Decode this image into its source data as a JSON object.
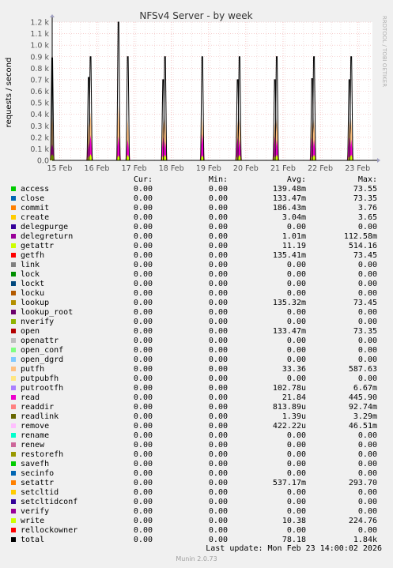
{
  "chart_data": {
    "type": "area",
    "title": "NFSv4 Server - by week",
    "ylabel": "requests / second",
    "watermark": "RRDTOOL / TOBI OETIKER",
    "ylim": [
      0,
      1200
    ],
    "yticks": [
      {
        "v": 0,
        "label": "0.0"
      },
      {
        "v": 100,
        "label": "0.1 k"
      },
      {
        "v": 200,
        "label": "0.2 k"
      },
      {
        "v": 300,
        "label": "0.3 k"
      },
      {
        "v": 400,
        "label": "0.4 k"
      },
      {
        "v": 500,
        "label": "0.5 k"
      },
      {
        "v": 600,
        "label": "0.6 k"
      },
      {
        "v": 700,
        "label": "0.7 k"
      },
      {
        "v": 800,
        "label": "0.8 k"
      },
      {
        "v": 900,
        "label": "0.9 k"
      },
      {
        "v": 1000,
        "label": "1.0 k"
      },
      {
        "v": 1100,
        "label": "1.1 k"
      },
      {
        "v": 1200,
        "label": "1.2 k"
      }
    ],
    "xlim": [
      0,
      8.6
    ],
    "xticks": [
      {
        "v": 0.2,
        "label": "15 Feb"
      },
      {
        "v": 1.2,
        "label": "16 Feb"
      },
      {
        "v": 2.2,
        "label": "17 Feb"
      },
      {
        "v": 3.2,
        "label": "18 Feb"
      },
      {
        "v": 4.2,
        "label": "19 Feb"
      },
      {
        "v": 5.2,
        "label": "20 Feb"
      },
      {
        "v": 6.2,
        "label": "21 Feb"
      },
      {
        "v": 7.2,
        "label": "22 Feb"
      },
      {
        "v": 8.2,
        "label": "23 Feb"
      }
    ],
    "spikes": [
      {
        "x": 0.0,
        "total": 890,
        "putfh": 455,
        "read": 170,
        "write": 65
      },
      {
        "x": 0.98,
        "total": 720,
        "putfh": 330,
        "read": 150,
        "write": 40
      },
      {
        "x": 1.03,
        "total": 900,
        "putfh": 420,
        "read": 220,
        "write": 55
      },
      {
        "x": 1.78,
        "total": 1200,
        "putfh": 480,
        "read": 210,
        "write": 45
      },
      {
        "x": 2.03,
        "total": 900,
        "putfh": 360,
        "read": 180,
        "write": 50
      },
      {
        "x": 2.98,
        "total": 700,
        "putfh": 340,
        "read": 200,
        "write": 45
      },
      {
        "x": 3.03,
        "total": 900,
        "putfh": 360,
        "read": 170,
        "write": 50
      },
      {
        "x": 4.03,
        "total": 900,
        "putfh": 370,
        "read": 230,
        "write": 45
      },
      {
        "x": 4.98,
        "total": 700,
        "putfh": 340,
        "read": 200,
        "write": 40
      },
      {
        "x": 5.03,
        "total": 900,
        "putfh": 360,
        "read": 180,
        "write": 50
      },
      {
        "x": 5.98,
        "total": 700,
        "putfh": 330,
        "read": 210,
        "write": 45
      },
      {
        "x": 6.03,
        "total": 900,
        "putfh": 360,
        "read": 180,
        "write": 50
      },
      {
        "x": 6.98,
        "total": 710,
        "putfh": 330,
        "read": 200,
        "write": 45
      },
      {
        "x": 7.03,
        "total": 900,
        "putfh": 360,
        "read": 180,
        "write": 50
      },
      {
        "x": 7.98,
        "total": 700,
        "putfh": 340,
        "read": 200,
        "write": 40
      },
      {
        "x": 8.03,
        "total": 900,
        "putfh": 360,
        "read": 180,
        "write": 50
      }
    ],
    "grid": true
  },
  "legend": {
    "headers": {
      "cur": "Cur:",
      "min": "Min:",
      "avg": "Avg:",
      "max": "Max:"
    },
    "rows": [
      {
        "name": "access",
        "color": "#00cc00",
        "cur": "0.00",
        "min": "0.00",
        "avg": "139.48m",
        "max": "73.55"
      },
      {
        "name": "close",
        "color": "#0066b3",
        "cur": "0.00",
        "min": "0.00",
        "avg": "133.47m",
        "max": "73.35"
      },
      {
        "name": "commit",
        "color": "#ff8000",
        "cur": "0.00",
        "min": "0.00",
        "avg": "186.43m",
        "max": "3.76"
      },
      {
        "name": "create",
        "color": "#ffcc00",
        "cur": "0.00",
        "min": "0.00",
        "avg": "3.04m",
        "max": "3.65"
      },
      {
        "name": "delegpurge",
        "color": "#330099",
        "cur": "0.00",
        "min": "0.00",
        "avg": "0.00",
        "max": "0.00"
      },
      {
        "name": "delegreturn",
        "color": "#990099",
        "cur": "0.00",
        "min": "0.00",
        "avg": "1.01m",
        "max": "112.58m"
      },
      {
        "name": "getattr",
        "color": "#ccff00",
        "cur": "0.00",
        "min": "0.00",
        "avg": "11.19",
        "max": "514.16"
      },
      {
        "name": "getfh",
        "color": "#ff0000",
        "cur": "0.00",
        "min": "0.00",
        "avg": "135.41m",
        "max": "73.45"
      },
      {
        "name": "link",
        "color": "#808080",
        "cur": "0.00",
        "min": "0.00",
        "avg": "0.00",
        "max": "0.00"
      },
      {
        "name": "lock",
        "color": "#008f00",
        "cur": "0.00",
        "min": "0.00",
        "avg": "0.00",
        "max": "0.00"
      },
      {
        "name": "lockt",
        "color": "#00487d",
        "cur": "0.00",
        "min": "0.00",
        "avg": "0.00",
        "max": "0.00"
      },
      {
        "name": "locku",
        "color": "#b35a00",
        "cur": "0.00",
        "min": "0.00",
        "avg": "0.00",
        "max": "0.00"
      },
      {
        "name": "lookup",
        "color": "#b38f00",
        "cur": "0.00",
        "min": "0.00",
        "avg": "135.32m",
        "max": "73.45"
      },
      {
        "name": "lookup_root",
        "color": "#6b006b",
        "cur": "0.00",
        "min": "0.00",
        "avg": "0.00",
        "max": "0.00"
      },
      {
        "name": "nverify",
        "color": "#8fb300",
        "cur": "0.00",
        "min": "0.00",
        "avg": "0.00",
        "max": "0.00"
      },
      {
        "name": "open",
        "color": "#b30000",
        "cur": "0.00",
        "min": "0.00",
        "avg": "133.47m",
        "max": "73.35"
      },
      {
        "name": "openattr",
        "color": "#bebebe",
        "cur": "0.00",
        "min": "0.00",
        "avg": "0.00",
        "max": "0.00"
      },
      {
        "name": "open_conf",
        "color": "#80ff80",
        "cur": "0.00",
        "min": "0.00",
        "avg": "0.00",
        "max": "0.00"
      },
      {
        "name": "open_dgrd",
        "color": "#80c9ff",
        "cur": "0.00",
        "min": "0.00",
        "avg": "0.00",
        "max": "0.00"
      },
      {
        "name": "putfh",
        "color": "#ffc080",
        "cur": "0.00",
        "min": "0.00",
        "avg": "33.36",
        "max": "587.63"
      },
      {
        "name": "putpubfh",
        "color": "#ffe680",
        "cur": "0.00",
        "min": "0.00",
        "avg": "0.00",
        "max": "0.00"
      },
      {
        "name": "putrootfh",
        "color": "#aa80ff",
        "cur": "0.00",
        "min": "0.00",
        "avg": "102.78u",
        "max": "6.67m"
      },
      {
        "name": "read",
        "color": "#ee00cc",
        "cur": "0.00",
        "min": "0.00",
        "avg": "21.84",
        "max": "445.90"
      },
      {
        "name": "readdir",
        "color": "#ff8080",
        "cur": "0.00",
        "min": "0.00",
        "avg": "813.89u",
        "max": "92.74m"
      },
      {
        "name": "readlink",
        "color": "#666600",
        "cur": "0.00",
        "min": "0.00",
        "avg": "1.39u",
        "max": "3.29m"
      },
      {
        "name": "remove",
        "color": "#ffbfff",
        "cur": "0.00",
        "min": "0.00",
        "avg": "422.22u",
        "max": "46.51m"
      },
      {
        "name": "rename",
        "color": "#00ffcc",
        "cur": "0.00",
        "min": "0.00",
        "avg": "0.00",
        "max": "0.00"
      },
      {
        "name": "renew",
        "color": "#cc6699",
        "cur": "0.00",
        "min": "0.00",
        "avg": "0.00",
        "max": "0.00"
      },
      {
        "name": "restorefh",
        "color": "#999900",
        "cur": "0.00",
        "min": "0.00",
        "avg": "0.00",
        "max": "0.00"
      },
      {
        "name": "savefh",
        "color": "#00cc00",
        "cur": "0.00",
        "min": "0.00",
        "avg": "0.00",
        "max": "0.00"
      },
      {
        "name": "secinfo",
        "color": "#0066b3",
        "cur": "0.00",
        "min": "0.00",
        "avg": "0.00",
        "max": "0.00"
      },
      {
        "name": "setattr",
        "color": "#ff8000",
        "cur": "0.00",
        "min": "0.00",
        "avg": "537.17m",
        "max": "293.70"
      },
      {
        "name": "setcltid",
        "color": "#ffcc00",
        "cur": "0.00",
        "min": "0.00",
        "avg": "0.00",
        "max": "0.00"
      },
      {
        "name": "setcltidconf",
        "color": "#330099",
        "cur": "0.00",
        "min": "0.00",
        "avg": "0.00",
        "max": "0.00"
      },
      {
        "name": "verify",
        "color": "#990099",
        "cur": "0.00",
        "min": "0.00",
        "avg": "0.00",
        "max": "0.00"
      },
      {
        "name": "write",
        "color": "#ccff00",
        "cur": "0.00",
        "min": "0.00",
        "avg": "10.38",
        "max": "224.76"
      },
      {
        "name": "rellockowner",
        "color": "#ff0000",
        "cur": "0.00",
        "min": "0.00",
        "avg": "0.00",
        "max": "0.00"
      },
      {
        "name": "total",
        "color": "#000000",
        "cur": "0.00",
        "min": "0.00",
        "avg": "78.18",
        "max": "1.84k"
      }
    ]
  },
  "footer": {
    "last_update": "Last update: Mon Feb 23 14:00:02 2026",
    "version": "Munin 2.0.73"
  }
}
